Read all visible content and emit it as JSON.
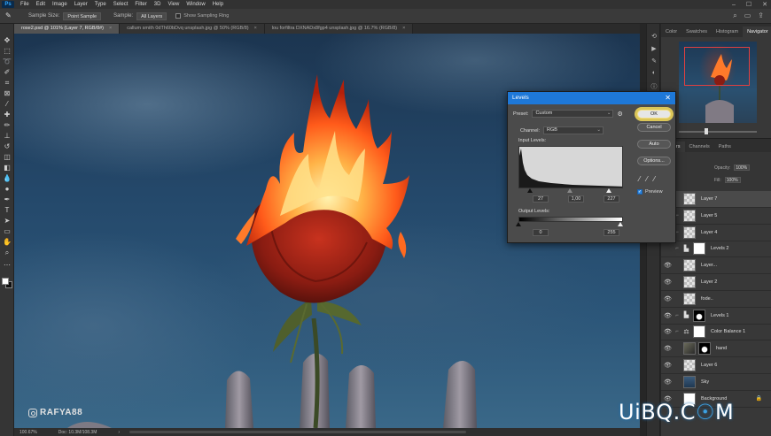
{
  "app": {
    "logo_text": "Ps"
  },
  "menu": [
    "File",
    "Edit",
    "Image",
    "Layer",
    "Type",
    "Select",
    "Filter",
    "3D",
    "View",
    "Window",
    "Help"
  ],
  "window_controls": {
    "min": "–",
    "max": "☐",
    "close": "✕"
  },
  "options_bar": {
    "tool_icon": "eyedropper-icon",
    "sample_size_label": "Sample Size:",
    "sample_size_value": "Point Sample",
    "sample_label": "Sample:",
    "sample_value": "All Layers",
    "show_ring_label": "Show Sampling Ring"
  },
  "tabs": [
    {
      "title": "rose2.psd @ 101% (Layer 7, RGB/8#)",
      "close": "×",
      "active": true
    },
    {
      "title": "callum smith 0dTh60bDvq unsplash.jpg @ 50% (RGB/8)",
      "close": "×",
      "active": false
    },
    {
      "title": "lou forfiltra DXNADx8fgp4 unsplash.jpg @ 16.7% (RGB/8)",
      "close": "×",
      "active": false
    }
  ],
  "canvas": {
    "watermark": "RAFYA88"
  },
  "status_bar": {
    "zoom": "100.67%",
    "doc": "Doc: 10.3M/108.3M",
    "arrow": "›"
  },
  "navigator": {
    "tabs": [
      "Color",
      "Swatches",
      "Histogram",
      "Navigator"
    ],
    "active_tab": "Navigator",
    "zoom_level": 0.35
  },
  "layers_panel": {
    "tabs": [
      "Layers",
      "Channels",
      "Paths"
    ],
    "opacity_label": "Opacity:",
    "opacity_value": "100%",
    "fill_label": "Fill:",
    "fill_value": "100%",
    "layers": [
      {
        "name": "Layer 7",
        "thumb": "checker",
        "mask": "",
        "adj": "",
        "visible": false,
        "selected": true,
        "linked": false,
        "lock": ""
      },
      {
        "name": "Layer 5",
        "thumb": "checker",
        "mask": "",
        "adj": "",
        "visible": false,
        "selected": false,
        "linked": true,
        "lock": ""
      },
      {
        "name": "Layer 4",
        "thumb": "checker",
        "mask": "",
        "adj": "",
        "visible": false,
        "selected": false,
        "linked": true,
        "lock": ""
      },
      {
        "name": "Levels 2",
        "thumb": "",
        "mask": "white",
        "adj": "levels",
        "visible": false,
        "selected": false,
        "linked": true,
        "lock": ""
      },
      {
        "name": "Layer...",
        "thumb": "checker",
        "mask": "",
        "adj": "",
        "visible": true,
        "selected": false,
        "linked": false,
        "lock": ""
      },
      {
        "name": "Layer 2",
        "thumb": "checker",
        "mask": "",
        "adj": "",
        "visible": true,
        "selected": false,
        "linked": false,
        "lock": ""
      },
      {
        "name": "fode..",
        "thumb": "checker",
        "mask": "",
        "adj": "",
        "visible": true,
        "selected": false,
        "linked": false,
        "lock": ""
      },
      {
        "name": "Levels 1",
        "thumb": "",
        "mask": "dark",
        "adj": "levels",
        "visible": true,
        "selected": false,
        "linked": true,
        "lock": ""
      },
      {
        "name": "Color Balance 1",
        "thumb": "",
        "mask": "white",
        "adj": "balance",
        "visible": true,
        "selected": false,
        "linked": true,
        "lock": ""
      },
      {
        "name": "hand",
        "thumb": "photo",
        "mask": "dark",
        "adj": "",
        "visible": true,
        "selected": false,
        "linked": false,
        "lock": ""
      },
      {
        "name": "Layer 6",
        "thumb": "checker",
        "mask": "",
        "adj": "",
        "visible": true,
        "selected": false,
        "linked": false,
        "lock": ""
      },
      {
        "name": "Sky",
        "thumb": "sky",
        "mask": "",
        "adj": "",
        "visible": true,
        "selected": false,
        "linked": false,
        "lock": ""
      },
      {
        "name": "Background",
        "thumb": "white",
        "mask": "",
        "adj": "",
        "visible": true,
        "selected": false,
        "linked": false,
        "lock": "🔒"
      }
    ]
  },
  "levels_dialog": {
    "title": "Levels",
    "close": "✕",
    "preset_label": "Preset:",
    "preset_value": "Custom",
    "channel_label": "Channel:",
    "channel_value": "RGB",
    "input_label": "Input Levels:",
    "input_black": "27",
    "input_gray": "1,00",
    "input_white": "227",
    "output_label": "Output Levels:",
    "output_black": "0",
    "output_white": "255",
    "buttons": {
      "ok": "OK",
      "cancel": "Cancel",
      "auto": "Auto",
      "options": "Options..."
    },
    "preview_label": "Preview",
    "preview_checked": true
  },
  "site_logo": {
    "prefix": "UiBQ.C",
    "ring": "☉",
    "suffix": "M"
  },
  "colors": {
    "accent": "#1e78d8",
    "highlight": "#f5dc5a",
    "bg": "#262626"
  }
}
